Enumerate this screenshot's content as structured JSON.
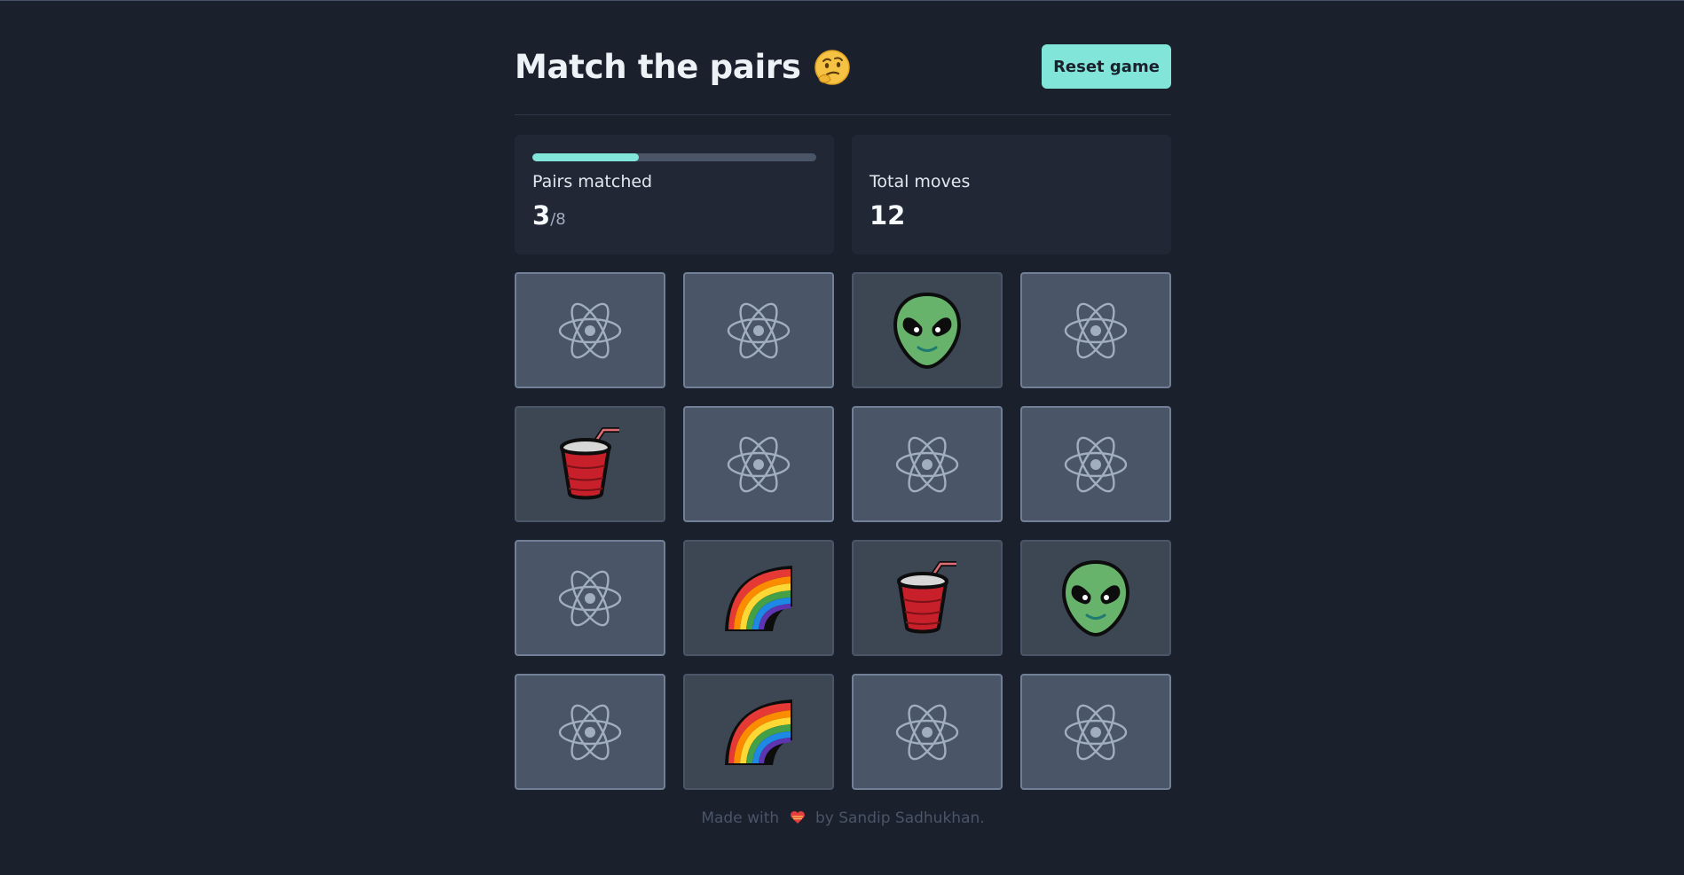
{
  "header": {
    "title": "Match the pairs",
    "title_emoji": "thinking-face",
    "reset_label": "Reset game"
  },
  "stats": {
    "pairs_label": "Pairs matched",
    "pairs_matched": "3",
    "pairs_total": "/8",
    "progress_fraction": 0.375,
    "moves_label": "Total moves",
    "moves": "12"
  },
  "cards": [
    {
      "state": "hidden",
      "face": "atom-icon"
    },
    {
      "state": "hidden",
      "face": "atom-icon"
    },
    {
      "state": "revealed",
      "face": "alien-icon"
    },
    {
      "state": "hidden",
      "face": "atom-icon"
    },
    {
      "state": "revealed",
      "face": "cup-icon"
    },
    {
      "state": "hidden",
      "face": "atom-icon"
    },
    {
      "state": "hidden",
      "face": "atom-icon"
    },
    {
      "state": "hidden",
      "face": "atom-icon"
    },
    {
      "state": "hidden",
      "face": "atom-icon"
    },
    {
      "state": "revealed",
      "face": "rainbow-icon"
    },
    {
      "state": "revealed",
      "face": "cup-icon"
    },
    {
      "state": "revealed",
      "face": "alien-icon"
    },
    {
      "state": "hidden",
      "face": "atom-icon"
    },
    {
      "state": "revealed",
      "face": "rainbow-icon"
    },
    {
      "state": "hidden",
      "face": "atom-icon"
    },
    {
      "state": "hidden",
      "face": "atom-icon"
    }
  ],
  "footer": {
    "before": "Made with",
    "after": "by Sandip Sadhukhan."
  },
  "colors": {
    "accent": "#81e6d9",
    "background": "#1a202c",
    "panel": "#212734",
    "card_hidden": "#4a5568",
    "card_revealed": "#3d4754"
  }
}
